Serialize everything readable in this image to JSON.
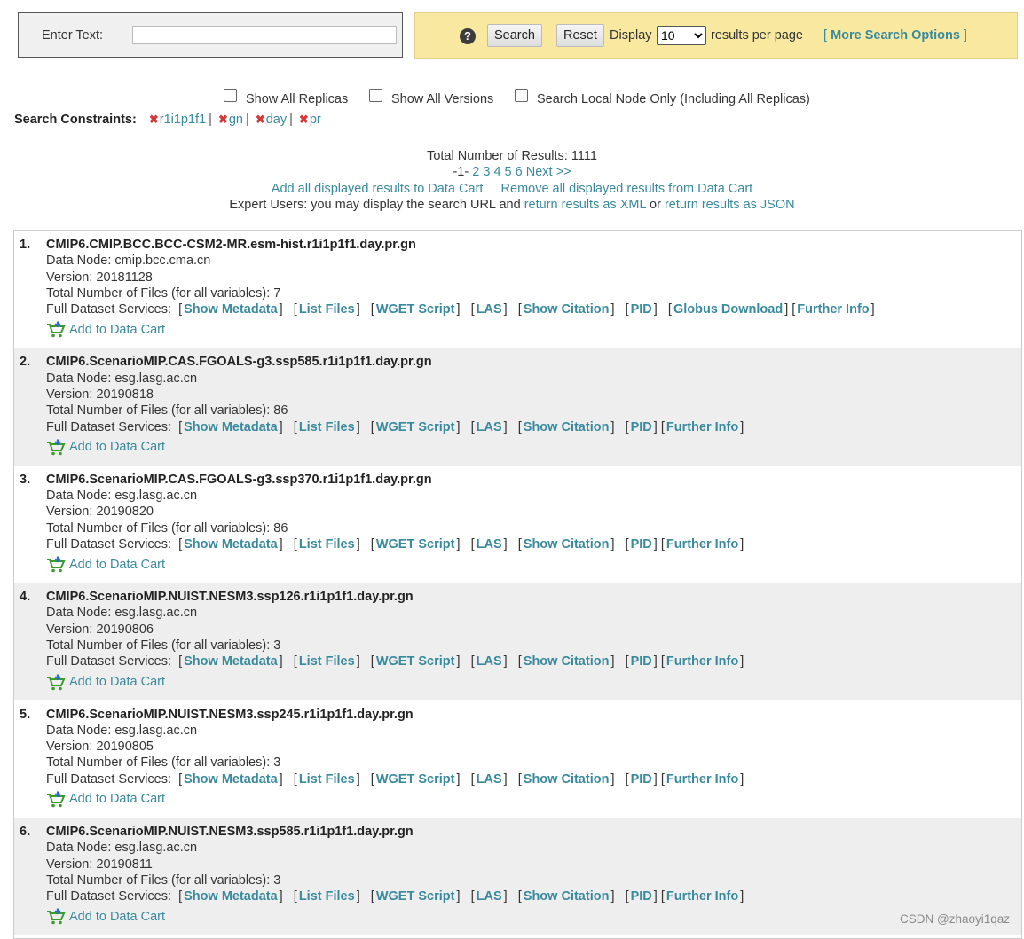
{
  "search": {
    "enter_text_label": "Enter Text:",
    "input_value": "",
    "search_label": "Search",
    "reset_label": "Reset",
    "display_label": "Display",
    "per_page_value": "10",
    "per_page_suffix": "results per page",
    "more_options": "More Search Options"
  },
  "options": {
    "show_all_replicas": "Show All Replicas",
    "show_all_versions": "Show All Versions",
    "local_node_only": "Search Local Node Only (Including All Replicas)"
  },
  "constraints": {
    "label": "Search Constraints:",
    "items": [
      "r1i1p1f1",
      "gn",
      "day",
      "pr"
    ]
  },
  "summary": {
    "total_label": "Total Number of Results: 1111",
    "current_page": "-1-",
    "pages": [
      "2",
      "3",
      "4",
      "5",
      "6"
    ],
    "next": "Next >>",
    "add_all": "Add all displayed results to Data Cart",
    "remove_all": "Remove all displayed results from Data Cart",
    "expert_prefix": "Expert Users: you may display the search URL and",
    "xml_link": "return results as XML",
    "or": "or",
    "json_link": "return results as JSON"
  },
  "labels": {
    "data_node": "Data Node:",
    "version": "Version:",
    "total_files": "Total Number of Files (for all variables):",
    "services": "Full Dataset Services:",
    "add_to_cart": "Add to Data Cart"
  },
  "services": {
    "show_metadata": "Show Metadata",
    "list_files": "List Files",
    "wget_script": "WGET Script",
    "las": "LAS",
    "show_citation": "Show Citation",
    "pid": "PID",
    "globus": "Globus Download",
    "further_info": "Further Info"
  },
  "results": [
    {
      "num": "1.",
      "title": "CMIP6.CMIP.BCC.BCC-CSM2-MR.esm-hist.r1i1p1f1.day.pr.gn",
      "node": "cmip.bcc.cma.cn",
      "version": "20181128",
      "files": "7",
      "globus": true
    },
    {
      "num": "2.",
      "title": "CMIP6.ScenarioMIP.CAS.FGOALS-g3.ssp585.r1i1p1f1.day.pr.gn",
      "node": "esg.lasg.ac.cn",
      "version": "20190818",
      "files": "86",
      "globus": false
    },
    {
      "num": "3.",
      "title": "CMIP6.ScenarioMIP.CAS.FGOALS-g3.ssp370.r1i1p1f1.day.pr.gn",
      "node": "esg.lasg.ac.cn",
      "version": "20190820",
      "files": "86",
      "globus": false
    },
    {
      "num": "4.",
      "title": "CMIP6.ScenarioMIP.NUIST.NESM3.ssp126.r1i1p1f1.day.pr.gn",
      "node": "esg.lasg.ac.cn",
      "version": "20190806",
      "files": "3",
      "globus": false
    },
    {
      "num": "5.",
      "title": "CMIP6.ScenarioMIP.NUIST.NESM3.ssp245.r1i1p1f1.day.pr.gn",
      "node": "esg.lasg.ac.cn",
      "version": "20190805",
      "files": "3",
      "globus": false
    },
    {
      "num": "6.",
      "title": "CMIP6.ScenarioMIP.NUIST.NESM3.ssp585.r1i1p1f1.day.pr.gn",
      "node": "esg.lasg.ac.cn",
      "version": "20190811",
      "files": "3",
      "globus": false
    }
  ],
  "watermark": "CSDN @zhaoyi1qaz"
}
